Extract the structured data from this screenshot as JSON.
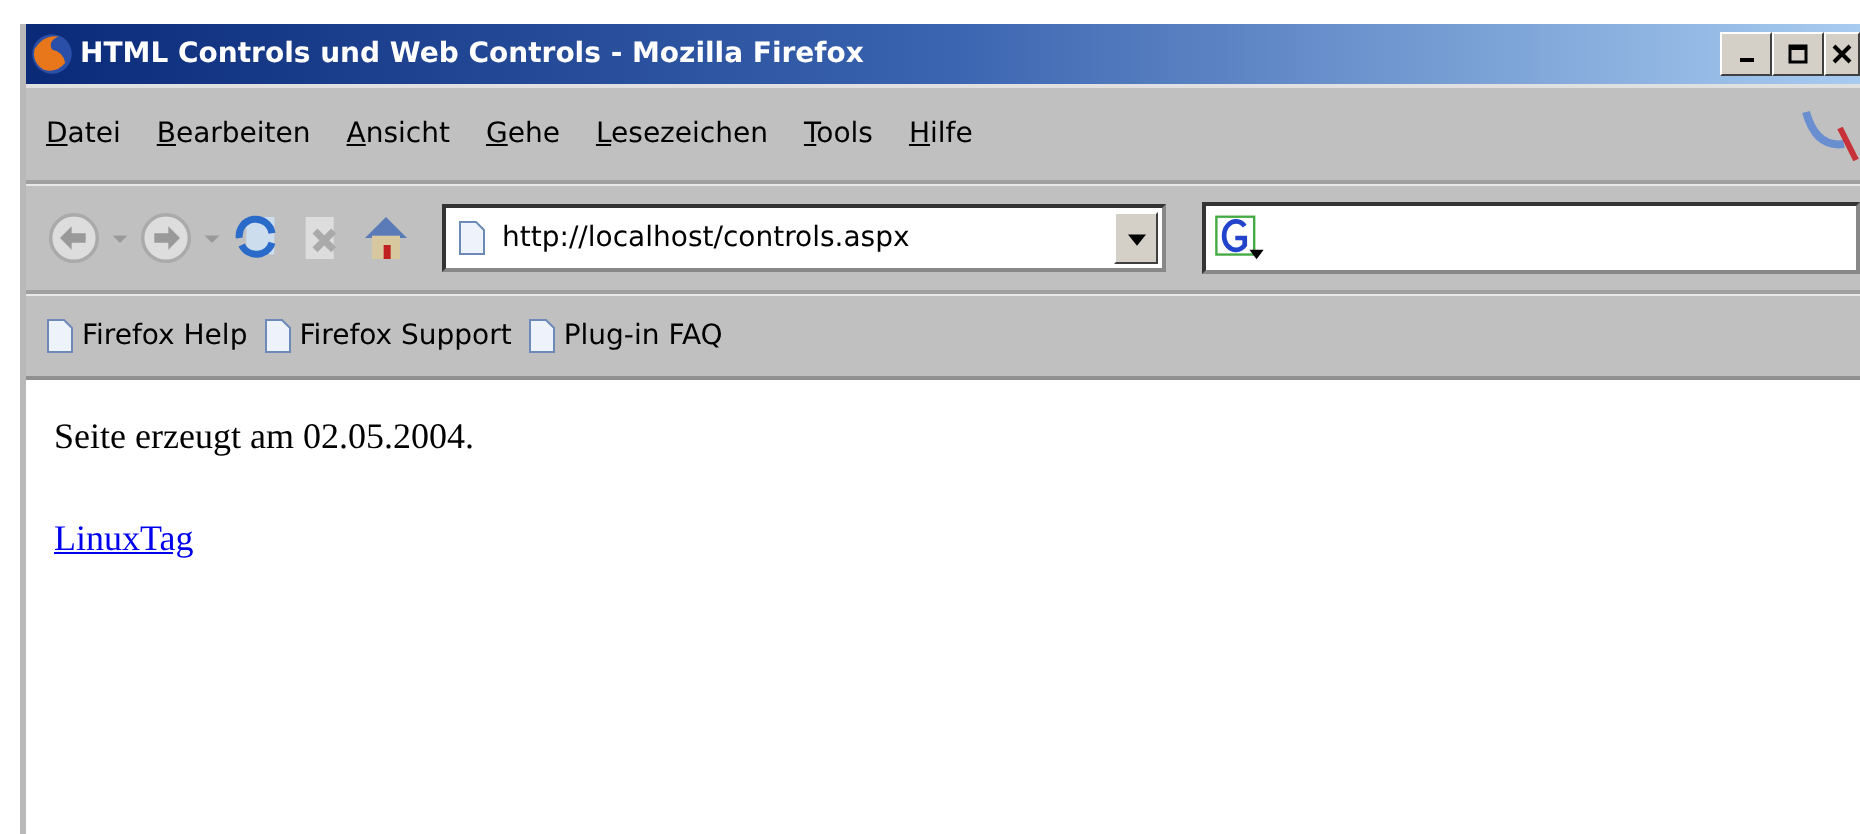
{
  "window": {
    "title": "HTML Controls und Web Controls - Mozilla Firefox"
  },
  "menu": [
    "Datei",
    "Bearbeiten",
    "Ansicht",
    "Gehe",
    "Lesezeichen",
    "Tools",
    "Hilfe"
  ],
  "toolbar": {
    "address": "http://localhost/controls.aspx"
  },
  "bookmarks": [
    "Firefox Help",
    "Firefox Support",
    "Plug-in FAQ"
  ],
  "content": {
    "text": "Seite erzeugt am 02.05.2004.",
    "link": "LinuxTag"
  }
}
